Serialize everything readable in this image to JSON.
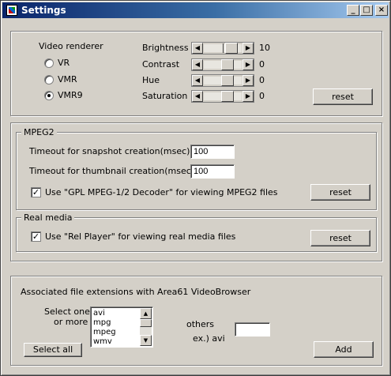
{
  "window": {
    "title": "Settings",
    "minimize": "_",
    "maximize": "□",
    "close": "×"
  },
  "video": {
    "renderer_label": "Video renderer",
    "renderers": [
      {
        "label": "VR",
        "selected": false
      },
      {
        "label": "VMR",
        "selected": false
      },
      {
        "label": "VMR9",
        "selected": true
      }
    ],
    "adjustments": [
      {
        "label": "Brightness",
        "value": "10",
        "level": 0.55
      },
      {
        "label": "Contrast",
        "value": "0",
        "level": 0.5
      },
      {
        "label": "Hue",
        "value": "0",
        "level": 0.5
      },
      {
        "label": "Saturation",
        "value": "0",
        "level": 0.5
      }
    ],
    "reset_label": "reset"
  },
  "mpeg2": {
    "title": "MPEG2",
    "snapshot_label": "Timeout for snapshot creation(msec)",
    "snapshot_value": "100",
    "thumbnail_label": "Timeout for thumbnail creation(msec)",
    "thumbnail_value": "100",
    "decoder_check_label": "Use \"GPL MPEG-1/2 Decoder\" for viewing MPEG2 files",
    "decoder_checked": true,
    "reset_label": "reset"
  },
  "realmedia": {
    "title": "Real media",
    "player_check_label": "Use \"Rel Player\" for viewing real media files",
    "player_checked": true,
    "reset_label": "reset"
  },
  "associations": {
    "title": "Associated file extensions with Area61 VideoBrowser",
    "select_label_1": "Select one",
    "select_label_2": "or more",
    "extensions": [
      "avi",
      "mpg",
      "mpeg",
      "wmv"
    ],
    "select_all_label": "Select all",
    "others_label": "others",
    "example_label": "ex.) avi",
    "others_value": "",
    "add_label": "Add"
  }
}
